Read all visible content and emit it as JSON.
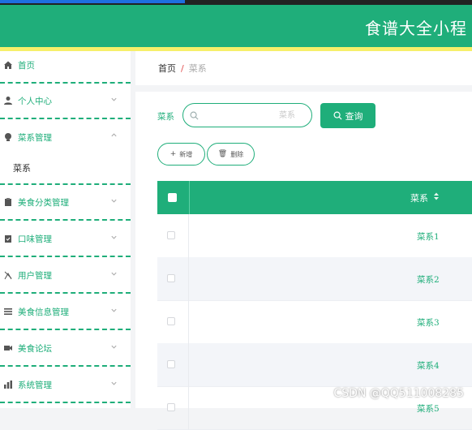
{
  "header": {
    "title": "食谱大全小程"
  },
  "sidebar": {
    "items": [
      {
        "label": "首页",
        "icon": "home-icon",
        "chevron": ""
      },
      {
        "label": "个人中心",
        "icon": "user-icon",
        "chevron": "down"
      },
      {
        "label": "菜系管理",
        "icon": "bulb-icon",
        "chevron": "up"
      },
      {
        "label": "菜系",
        "icon": "",
        "chevron": "",
        "sub": true
      },
      {
        "label": "美食分类管理",
        "icon": "clipboard-icon",
        "chevron": "down"
      },
      {
        "label": "口味管理",
        "icon": "clipboard-check-icon",
        "chevron": "down"
      },
      {
        "label": "用户管理",
        "icon": "user-manage-icon",
        "chevron": "down"
      },
      {
        "label": "美食信息管理",
        "icon": "list-icon",
        "chevron": "down"
      },
      {
        "label": "美食论坛",
        "icon": "video-icon",
        "chevron": "down"
      },
      {
        "label": "系统管理",
        "icon": "chart-icon",
        "chevron": "down"
      }
    ]
  },
  "breadcrumb": {
    "home": "首页",
    "separator": "/",
    "current": "菜系"
  },
  "search": {
    "label": "菜系",
    "placeholder": "菜系",
    "value": ""
  },
  "toolbar": {
    "query": "查询",
    "add": "新增",
    "delete": "删除"
  },
  "table": {
    "header": "菜系",
    "rows": [
      "菜系1",
      "菜系2",
      "菜系3",
      "菜系4",
      "菜系5"
    ]
  },
  "colors": {
    "primary": "#1fae7a",
    "accent_bar": "#f6ef6a"
  },
  "watermark": "CSDN @QQ511008285"
}
